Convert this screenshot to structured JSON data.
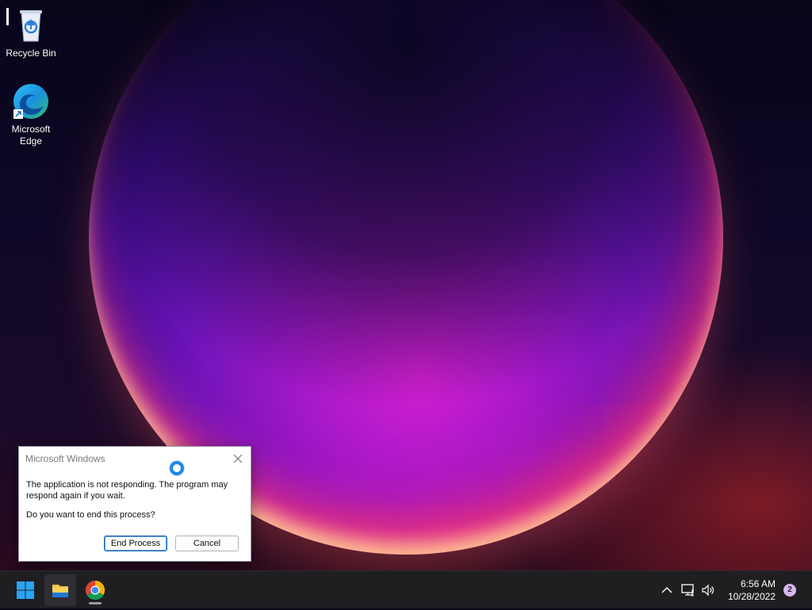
{
  "desktop": {
    "icons": [
      {
        "label": "Recycle Bin",
        "icon": "recycle-bin-icon"
      },
      {
        "label": "Microsoft\nEdge",
        "line1": "Microsoft",
        "line2": "Edge",
        "icon": "edge-icon"
      }
    ]
  },
  "dialog": {
    "title": "Microsoft Windows",
    "message": "The application is not responding. The program may respond again if you wait.",
    "question": "Do you want to end this process?",
    "end_process_label": "End Process",
    "cancel_label": "Cancel",
    "icons": {
      "close": "close-icon",
      "busy": "busy-spinner-icon"
    }
  },
  "taskbar": {
    "apps": [
      {
        "name": "Start",
        "icon": "windows-start-icon"
      },
      {
        "name": "File Explorer",
        "icon": "folder-icon"
      },
      {
        "name": "Google Chrome",
        "icon": "chrome-icon",
        "running": true
      }
    ],
    "tray": {
      "icons": [
        "chevron-up-icon",
        "network-icon",
        "volume-icon"
      ],
      "time": "6:56 AM",
      "date": "10/28/2022",
      "notification_count": "2"
    }
  },
  "colors": {
    "accent": "#1a66b5",
    "taskbar_bg": "#1f1f22",
    "badge": "#d8b8ee"
  }
}
